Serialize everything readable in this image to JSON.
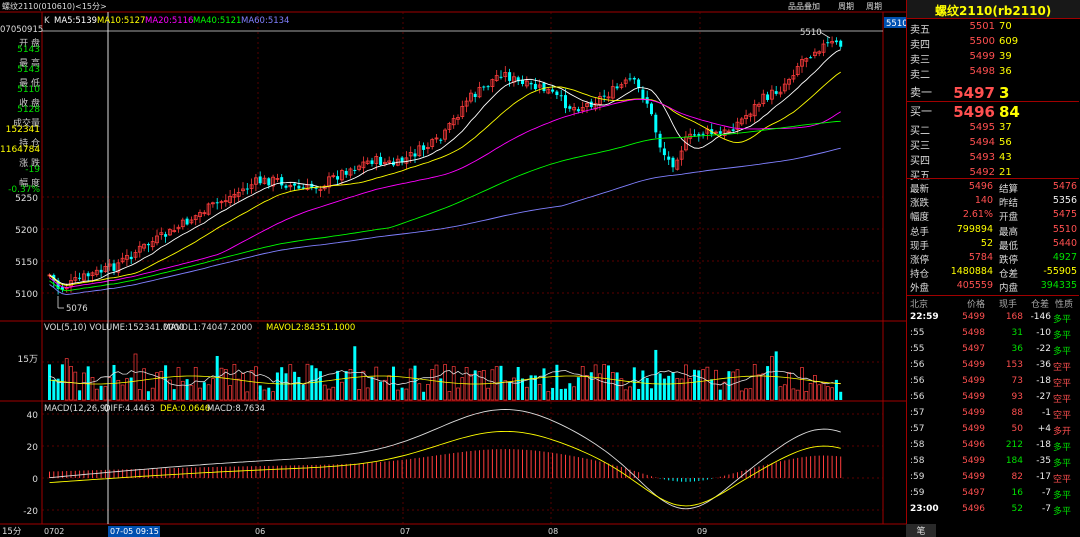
{
  "header": {
    "instrument": "螺纹2110(010610)<15分>",
    "k_label": "K",
    "ma5": "MA5:5139",
    "ma10": "MA10:5127",
    "ma20": "MA20:5116",
    "ma40": "MA40:5121",
    "ma60": "MA60:5134",
    "btn_products": "品品叠加",
    "btn_week": "周期",
    "btn_extra": "周期",
    "current_price_tag": "5510"
  },
  "left_panel": {
    "datetime": "07050915",
    "rows": [
      {
        "k": "开 盘",
        "v": "5143",
        "color": "green"
      },
      {
        "k": "最 高",
        "v": "5143",
        "color": "green"
      },
      {
        "k": "最 低",
        "v": "5110",
        "color": "green"
      },
      {
        "k": "收 盘",
        "v": "5128",
        "color": "green"
      },
      {
        "k": "成交量",
        "v": "152341",
        "color": "yellow"
      },
      {
        "k": "持 仓",
        "v": "1164784",
        "color": "yellow"
      },
      {
        "k": "涨 跌",
        "v": "-19",
        "color": "green"
      },
      {
        "k": "幅 度",
        "v": "-0.37%",
        "color": "green"
      }
    ]
  },
  "price_axis": [
    "5250",
    "5200",
    "5150",
    "5100"
  ],
  "annotations": {
    "high": "5510",
    "low": "5076"
  },
  "volume_panel": {
    "title": "VOL(5,10) VOLUME:152341.0000",
    "mavol1": "MAVOL1:74047.2000",
    "mavol2": "MAVOL2:84351.1000",
    "axis_label": "15万"
  },
  "macd_panel": {
    "title": "MACD(12,26,9)",
    "diff": "DIFF:4.4463",
    "dea": "DEA:0.0646",
    "macd": "MACD:8.7634",
    "axis": [
      "40",
      "20",
      "0",
      "-20"
    ]
  },
  "time_axis": {
    "period": "15分",
    "labels": [
      "0702",
      "06",
      "07",
      "08",
      "09"
    ],
    "cursor": "07-05 09:15"
  },
  "right_panel": {
    "title": "螺纹2110(rb2110)",
    "asks": [
      {
        "label": "卖五",
        "price": "5501",
        "vol": "70"
      },
      {
        "label": "卖四",
        "price": "5500",
        "vol": "609"
      },
      {
        "label": "卖三",
        "price": "5499",
        "vol": "39"
      },
      {
        "label": "卖二",
        "price": "5498",
        "vol": "36"
      },
      {
        "label": "卖一",
        "price": "5497",
        "vol": "3"
      }
    ],
    "bids": [
      {
        "label": "买一",
        "price": "5496",
        "vol": "84"
      },
      {
        "label": "买二",
        "price": "5495",
        "vol": "37"
      },
      {
        "label": "买三",
        "price": "5494",
        "vol": "56"
      },
      {
        "label": "买四",
        "price": "5493",
        "vol": "43"
      },
      {
        "label": "买五",
        "price": "5492",
        "vol": "21"
      }
    ],
    "stats": [
      {
        "k1": "最新",
        "v1": "5496",
        "c1": "red",
        "k2": "结算",
        "v2": "5476",
        "c2": "red"
      },
      {
        "k1": "涨跌",
        "v1": "140",
        "c1": "red",
        "k2": "昨结",
        "v2": "5356",
        "c2": "white"
      },
      {
        "k1": "幅度",
        "v1": "2.61%",
        "c1": "red",
        "k2": "开盘",
        "v2": "5475",
        "c2": "red"
      },
      {
        "k1": "总手",
        "v1": "799894",
        "c1": "yellow",
        "k2": "最高",
        "v2": "5510",
        "c2": "red"
      },
      {
        "k1": "现手",
        "v1": "52",
        "c1": "yellow",
        "k2": "最低",
        "v2": "5440",
        "c2": "red"
      },
      {
        "k1": "涨停",
        "v1": "5784",
        "c1": "red",
        "k2": "跌停",
        "v2": "4927",
        "c2": "green"
      },
      {
        "k1": "持仓",
        "v1": "1480884",
        "c1": "yellow",
        "k2": "仓差",
        "v2": "-55905",
        "c2": "yellow"
      },
      {
        "k1": "外盘",
        "v1": "405559",
        "c1": "red",
        "k2": "内盘",
        "v2": "394335",
        "c2": "green"
      }
    ],
    "ticks_header": {
      "c1": "北京",
      "c2": "价格",
      "c3": "现手",
      "c4": "仓差",
      "c5": "性质"
    },
    "ticks": [
      {
        "t": "22:59",
        "p": "5499",
        "v": "168",
        "d": "-146",
        "n": "多平",
        "pc": "red",
        "vc": "red",
        "nc": "green"
      },
      {
        "t": ":55",
        "p": "5498",
        "v": "31",
        "d": "-10",
        "n": "多平",
        "pc": "red",
        "vc": "green",
        "nc": "green"
      },
      {
        "t": ":55",
        "p": "5497",
        "v": "36",
        "d": "-22",
        "n": "多平",
        "pc": "red",
        "vc": "green",
        "nc": "green"
      },
      {
        "t": ":56",
        "p": "5499",
        "v": "153",
        "d": "-36",
        "n": "空平",
        "pc": "red",
        "vc": "red",
        "nc": "red"
      },
      {
        "t": ":56",
        "p": "5499",
        "v": "73",
        "d": "-18",
        "n": "空平",
        "pc": "red",
        "vc": "red",
        "nc": "red"
      },
      {
        "t": ":56",
        "p": "5499",
        "v": "93",
        "d": "-27",
        "n": "空平",
        "pc": "red",
        "vc": "red",
        "nc": "red"
      },
      {
        "t": ":57",
        "p": "5499",
        "v": "88",
        "d": "-1",
        "n": "空平",
        "pc": "red",
        "vc": "red",
        "nc": "red"
      },
      {
        "t": ":57",
        "p": "5499",
        "v": "50",
        "d": "+4",
        "n": "多开",
        "pc": "red",
        "vc": "red",
        "nc": "red"
      },
      {
        "t": ":58",
        "p": "5496",
        "v": "212",
        "d": "-18",
        "n": "多平",
        "pc": "red",
        "vc": "green",
        "nc": "green"
      },
      {
        "t": ":58",
        "p": "5499",
        "v": "184",
        "d": "-35",
        "n": "多平",
        "pc": "red",
        "vc": "green",
        "nc": "green"
      },
      {
        "t": ":59",
        "p": "5499",
        "v": "82",
        "d": "-17",
        "n": "空平",
        "pc": "red",
        "vc": "red",
        "nc": "red"
      },
      {
        "t": ":59",
        "p": "5497",
        "v": "16",
        "d": "-7",
        "n": "多平",
        "pc": "red",
        "vc": "green",
        "nc": "green"
      },
      {
        "t": "23:00",
        "p": "5496",
        "v": "52",
        "d": "-7",
        "n": "多平",
        "pc": "red",
        "vc": "green",
        "nc": "green"
      }
    ],
    "bottom_tab": "笔"
  },
  "colors": {
    "up": "#ff3c3c",
    "down": "#00ffff",
    "ma5": "#ffffff",
    "ma10": "#ffff00",
    "ma20": "#ff00ff",
    "ma40": "#00ff00",
    "ma60": "#8080ff",
    "grid": "#a00000"
  }
}
